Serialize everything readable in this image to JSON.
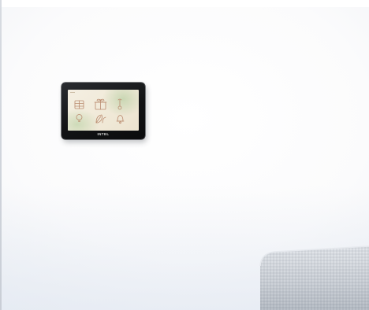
{
  "scene": {
    "description_colors": {
      "wall": "#f7f8fa",
      "panel_frame": "#141517",
      "screen_bg": "#f1ead9",
      "icon_stroke": "#b98a6e",
      "sofa": "#c8cdd4"
    }
  },
  "panel": {
    "logo_text": "INTEL",
    "screen_icons": [
      "keypad-icon",
      "gift-box-icon",
      "thermometer-icon",
      "lightbulb-icon",
      "leaf-icon",
      "bell-icon"
    ]
  }
}
